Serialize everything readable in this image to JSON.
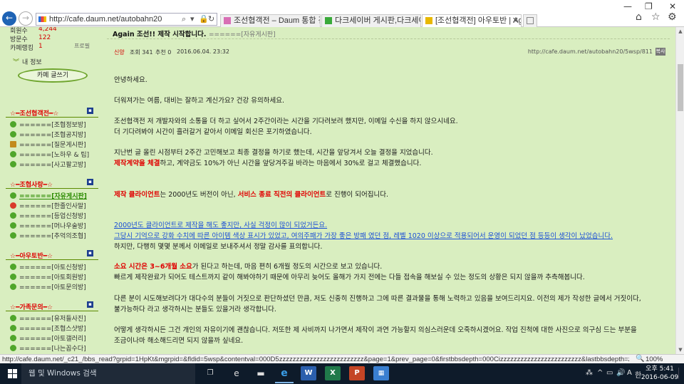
{
  "browser": {
    "address_url": "http://cafe.daum.net/autobahn20",
    "tabs": [
      {
        "label": "조선협객전 – Daum 통합 검색",
        "icon_color": "#d86fb5",
        "active": false
      },
      {
        "label": "다크세이버 게시판,다크세이버...",
        "icon_color": "#3aaa3a",
        "active": false
      },
      {
        "label": "[조선협객전] 아우토반 | Ag...",
        "icon_color": "#e8b800",
        "active": true
      }
    ]
  },
  "sidebar": {
    "stats": [
      {
        "label": "회원수",
        "value": "4,244"
      },
      {
        "label": "방문수",
        "value": "122"
      },
      {
        "label": "카페랭킹",
        "value": "1"
      }
    ],
    "fold_label": "프로필",
    "my_info": "내 정보",
    "write_button": "카페 글쓰기",
    "sections": [
      {
        "title": "☆━조선협객전━☆",
        "items": [
          {
            "label": "======[조협정보방]",
            "icon": "green"
          },
          {
            "label": "======[조협공지방]",
            "icon": "green"
          },
          {
            "label": "======[질문게시판]",
            "icon": "gold"
          },
          {
            "label": "======[노하우 & 팁]",
            "icon": "green"
          },
          {
            "label": "======[사고팔고방]",
            "icon": "green"
          }
        ]
      },
      {
        "title": "☆━조협사랑━☆",
        "items": [
          {
            "label": "======[자유게시판]",
            "icon": "green",
            "current": true
          },
          {
            "label": "======[한줄인사말]",
            "icon": "red"
          },
          {
            "label": "======[등업신청방]",
            "icon": "green"
          },
          {
            "label": "======[머나우술방]",
            "icon": "green"
          },
          {
            "label": "======[추억의조협]",
            "icon": "green"
          }
        ]
      },
      {
        "title": "☆━아우토반━☆",
        "items": [
          {
            "label": "======[아토신청방]",
            "icon": "green"
          },
          {
            "label": "======[아토회원방]",
            "icon": "green"
          },
          {
            "label": "======[아토문의방]",
            "icon": "green"
          }
        ]
      },
      {
        "title": "☆━가족문의━☆",
        "items": [
          {
            "label": "======[유저들사진]",
            "icon": "green"
          },
          {
            "label": "======[조협스샷방]",
            "icon": "green"
          },
          {
            "label": "======[아토갤러리]",
            "icon": "green"
          },
          {
            "label": "======[나는꼽수다]",
            "icon": "green"
          }
        ]
      }
    ]
  },
  "post": {
    "title": "Again 조선!! 제작 시작합니다.",
    "board": "======[자유게시판]",
    "author": "신양",
    "views": "조회 341",
    "recommends": "추천 0",
    "datetime": "2016.06.04. 23:32",
    "url": "http://cafe.daum.net/autobahn20/5wsp/811",
    "copy_label": "복사",
    "body": {
      "p1": "안녕하세요.",
      "p2": "더워져가는 여름, 대비는 잘하고 계신가요? 건강 유의하세요.",
      "p3a": "조선협객전 저 개발자와의 소통을 더 하고 싶어서 2주간이라는 시간을 기다려보려 했지만, 이메일 수신을 하지 않으시네요.",
      "p3b": "더 기다려봐야 시간이 흘러갈거 같아서 이메일 회신은 포기하였습니다.",
      "p4a": "지난번 글 올린 시점부터 2주간 고민해보고 최종 결정을 하기로 했는데, 시간을 앞당겨서 오늘 결정을 지었습니다.",
      "p4b_red": "제작계약을 체결",
      "p4b_rest": "하고, 계약금도 10%가 아닌 시간을 앞당겨주길 바라는 마음에서 30%로 걸고 체결했습니다.",
      "p5_red1": "제작 클라이언트",
      "p5_mid": "는 2000년도 버전이 아닌, ",
      "p5_red2": "서비스 종료 직전의 클라이언트",
      "p5_rest": "로 진행이 되어집니다.",
      "link1": "2000년도 클라이언트로 제작을 해도 좋지만, 사실 걱정이 많이 되었거든요.",
      "link2": "그당시 기억으로 강화 수치에 따른 아이템 색상 표시가 있었고, 여의주패가 가장 좋은 방패 였던 점, 레벨 1020 이상으로 적용되어서 운영이 되었던 점 등등이 생각이 났었습니다.",
      "p6": "하지만, 다행히 몇몇 분께서 이메일로 보내주셔서 정말 감사를 표의합니다.",
      "p7_red": "소요 시간은 3~6개월 소요",
      "p7_rest": "가 된다고 하는데, 마음 편히 6개월 정도의 시간으로 보고 있습니다.",
      "p7b": "빠르게 제작완료가 되어도 테스트까지 같이 해봐야하기 때문에 아무리 늦어도 올해가 가지 전에는 다들 접속을 해보실 수 있는 정도의 상황은 되지 않을까 추측해봅니다.",
      "p8a": "다른 분이 시도해보려다가 대다수의 분들이 거짓으로 판단하셨던 만큼, 저도 신중히 진행하고 그에 따른 결과물을 통해 노력하고 있음을 보여드리지요. 이전의 제가 작성한 글에서 거짓이다,",
      "p8b": "불가능하다 라고 생각하시는 분들도 있을거라 생각합니다.",
      "p9a": "어떻게 생각하시든 그건 개인의 자유이기에 괜찮습니다. 저또한 제 사비까지 나가면서 제작이 과연 가능할지 의심스러운데 오죽하시겠어요. 작업 진척에 대한 사진으로 의구심 드는 부분을",
      "p9b": "조금이나마 해소해드리면 되지 않을까 싶네요."
    }
  },
  "statusbar": {
    "text": "http://cafe.daum.net/_c21_/bbs_read?grpid=1HpKt&mgrpid=&fldid=5wsp&contentval=000D5zzzzzzzzzzzzzzzzzzzzzzzzz&page=1&prev_page=0&firstbbsdepth=000Cizzzzzzzzzzzzzzzzzzzzzzzz&lastbbsdepth=zzzzzzzzzz",
    "zoom": "100%"
  },
  "taskbar": {
    "search_placeholder": "웹 및 Windows 검색",
    "time": "오후 5:41",
    "date": "2016-06-09"
  }
}
